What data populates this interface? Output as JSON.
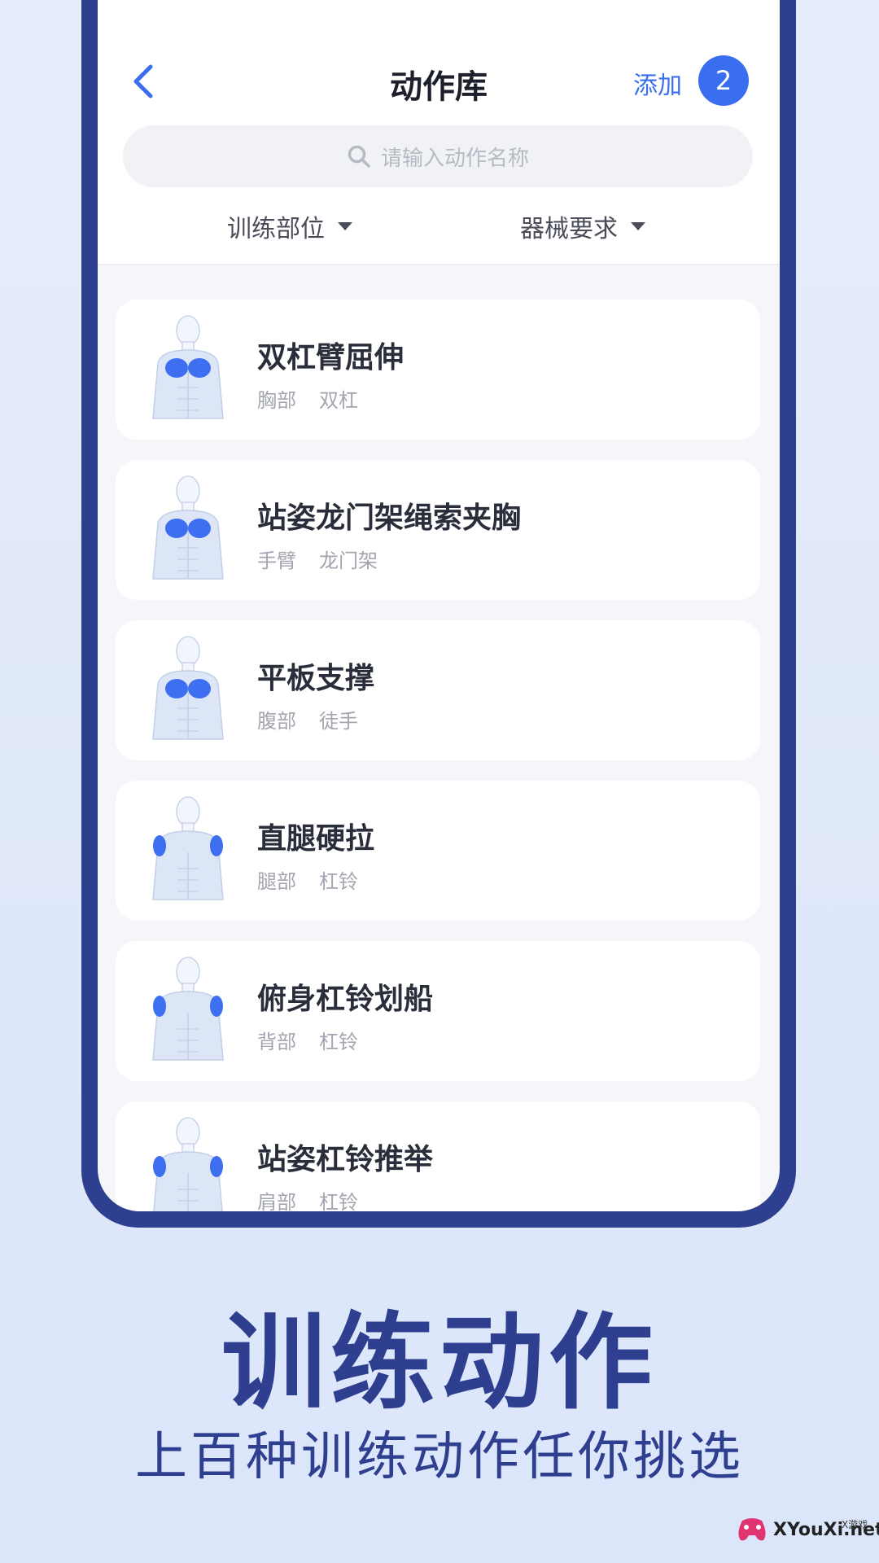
{
  "header": {
    "title": "动作库",
    "add_label": "添加",
    "count": "2"
  },
  "search": {
    "placeholder": "请输入动作名称"
  },
  "filters": {
    "body_part": "训练部位",
    "equipment": "器械要求"
  },
  "exercises": [
    {
      "name": "双杠臂屈伸",
      "part": "胸部",
      "equipment": "双杠",
      "highlight": "chest"
    },
    {
      "name": "站姿龙门架绳索夹胸",
      "part": "手臂",
      "equipment": "龙门架",
      "highlight": "chest"
    },
    {
      "name": "平板支撑",
      "part": "腹部",
      "equipment": "徒手",
      "highlight": "chest"
    },
    {
      "name": "直腿硬拉",
      "part": "腿部",
      "equipment": "杠铃",
      "highlight": "shoulders"
    },
    {
      "name": "俯身杠铃划船",
      "part": "背部",
      "equipment": "杠铃",
      "highlight": "shoulders"
    },
    {
      "name": "站姿杠铃推举",
      "part": "肩部",
      "equipment": "杠铃",
      "highlight": "shoulders"
    }
  ],
  "caption": {
    "headline": "训练动作",
    "tagline": "上百种训练动作任你挑选"
  },
  "watermark": {
    "site": "XYouXi.net",
    "small": "X游戏"
  },
  "colors": {
    "accent": "#3a6ef0",
    "frame": "#2e3f8f",
    "muscle": "#3d6ff0"
  }
}
